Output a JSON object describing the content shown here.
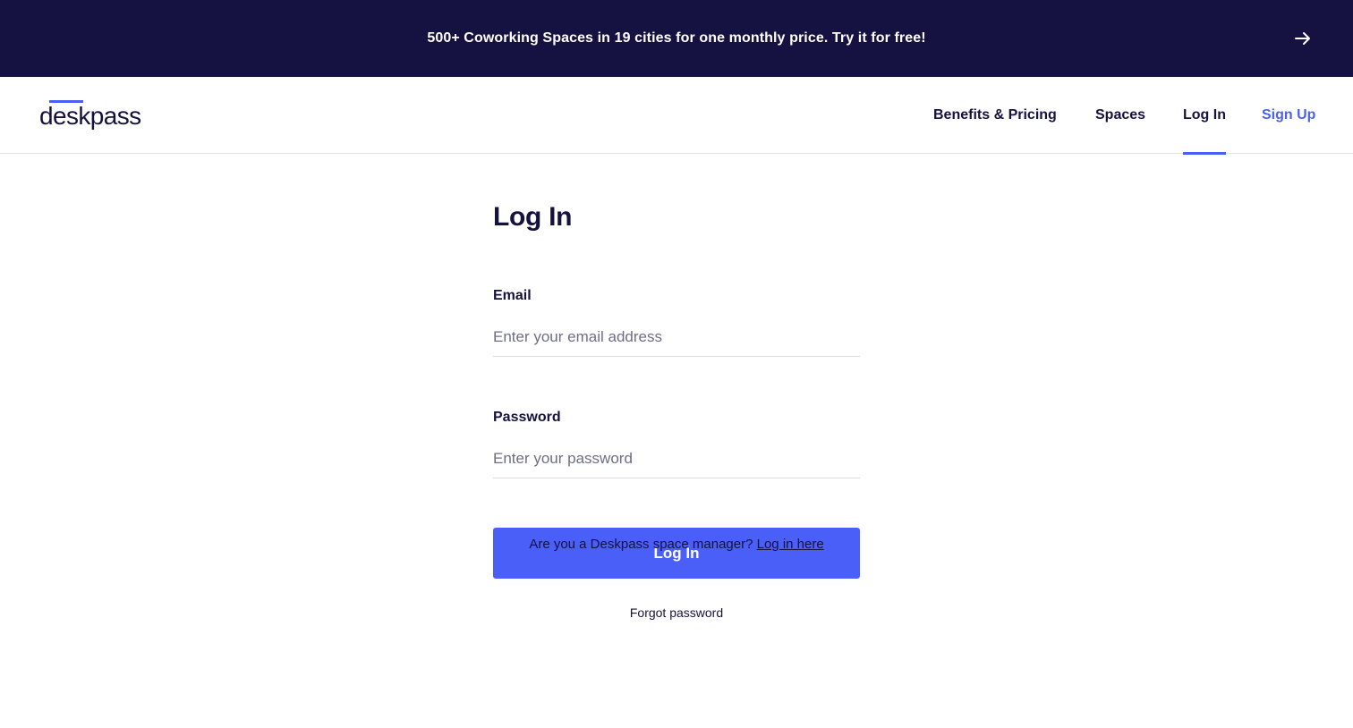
{
  "promo": {
    "text": "500+ Coworking Spaces in 19 cities for one monthly price. Try it for free!",
    "arrow_icon": "arrow-right-icon"
  },
  "nav": {
    "logo": "deskpass",
    "links": [
      {
        "label": "Benefits & Pricing"
      },
      {
        "label": "Spaces"
      },
      {
        "label": "Log In",
        "active": true
      },
      {
        "label": "Sign Up"
      }
    ]
  },
  "form": {
    "title": "Log In",
    "email_label": "Email",
    "email_placeholder": "Enter your email address",
    "password_label": "Password",
    "password_placeholder": "Enter your password",
    "submit_label": "Log In",
    "forgot_label": "Forgot password"
  },
  "footer": {
    "manager_text": "Are you a Deskpass space manager?",
    "manager_link": "Log in here"
  },
  "colors": {
    "navy": "#151140",
    "accent": "#4a5ff7",
    "text": "#15123f"
  }
}
